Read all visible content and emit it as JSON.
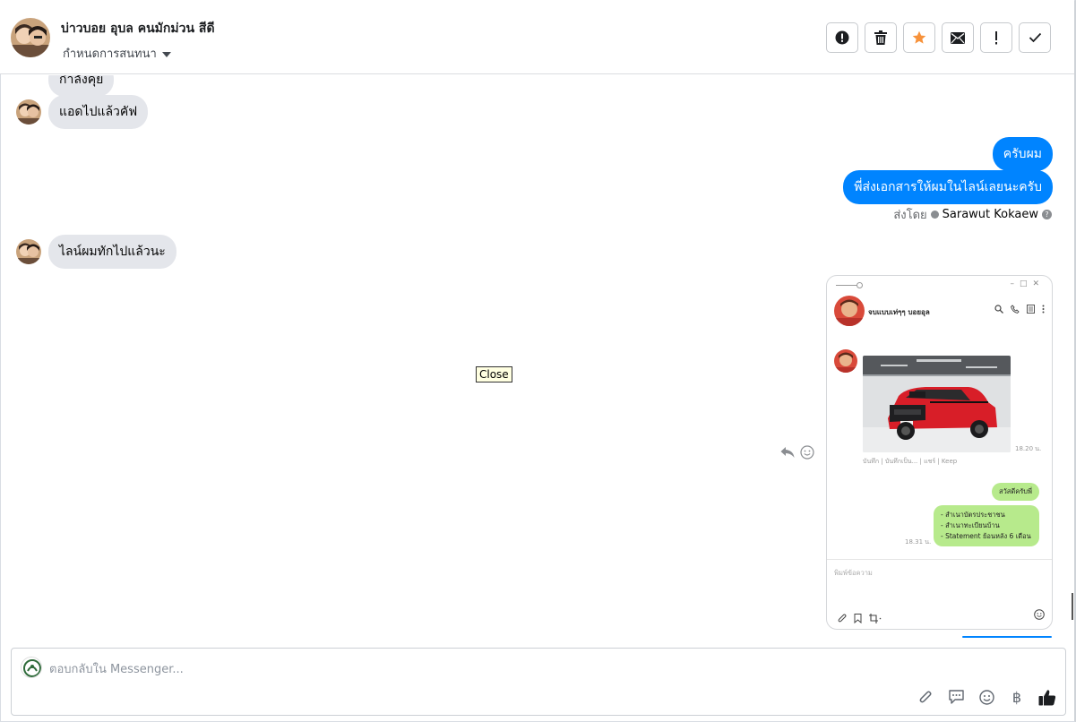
{
  "header": {
    "contact_name": "บ่าวบอย อุบล คนมักม่วน สีดี",
    "assign_label": "กำหนดการสนทนา",
    "actions": [
      {
        "name": "mark-spam-button",
        "icon": "alert-circle-icon"
      },
      {
        "name": "delete-button",
        "icon": "trash-icon"
      },
      {
        "name": "star-button",
        "icon": "star-icon"
      },
      {
        "name": "mark-unread-button",
        "icon": "envelope-icon"
      },
      {
        "name": "follow-up-button",
        "icon": "exclamation-icon"
      },
      {
        "name": "mark-done-button",
        "icon": "check-icon"
      }
    ],
    "star_color": "#f7923b"
  },
  "messages": {
    "partial_top": "กำลังคุย",
    "in_1": "แอดไปแล้วคัฟ",
    "out_1": "ครับผม",
    "out_2": "พี่ส่งเอกสารให้ผมในไลน์เลยนะครับ",
    "sent_by_label": "ส่งโดย",
    "sent_by_name": "Sarawut Kokaew",
    "in_2": "ไลน์ผมทักไปแล้วนะ",
    "outgoing_color": "#0084ff",
    "incoming_color": "#e4e6eb"
  },
  "tooltip": "Close",
  "attachment": {
    "chat_name": "จบแบบเท่ๆๆ บอยอุล",
    "time_1": "18.20 น.",
    "image_actions": "บันทึก | บันทึกเป็น... | แชร์ | Keep",
    "greeting": "สวัสดีครับพี่",
    "doc_list": [
      "- สำเนาบัตรประชาชน",
      "- สำเนาทะเบียนบ้าน",
      "- Statement ย้อนหลัง 6 เดือน"
    ],
    "time_2": "18.31 น.",
    "compose_placeholder": "พิมพ์ข้อความ",
    "bubble_color": "#b7ea8c"
  },
  "composer": {
    "placeholder": "ตอบกลับใน Messenger...",
    "tools": [
      "paperclip-icon",
      "saved-reply-icon",
      "emoji-icon",
      "baht-icon",
      "thumbs-up-icon"
    ],
    "baht_symbol": "฿"
  }
}
